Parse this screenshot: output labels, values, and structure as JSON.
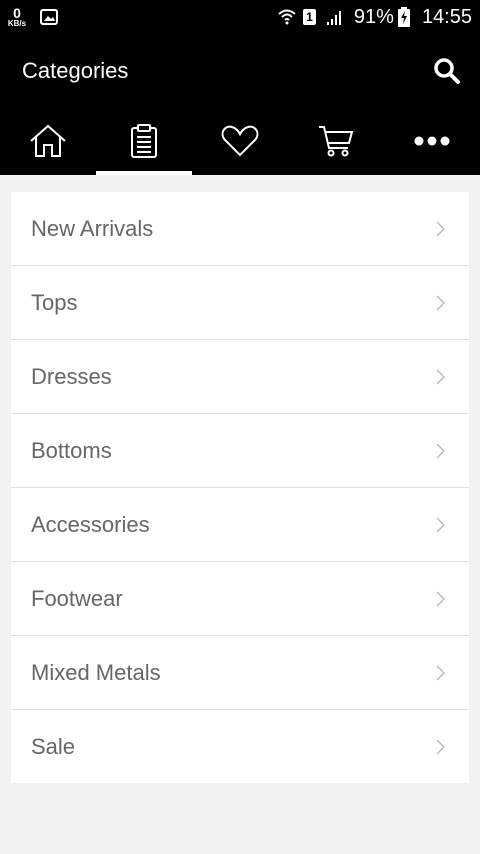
{
  "status_bar": {
    "speed_value": "0",
    "speed_unit": "KB/s",
    "battery_percent": "91%",
    "time": "14:55",
    "sim_slot": "1"
  },
  "header": {
    "title": "Categories"
  },
  "tabs": [
    {
      "icon": "home-icon",
      "active": false
    },
    {
      "icon": "clipboard-icon",
      "active": true
    },
    {
      "icon": "heart-icon",
      "active": false
    },
    {
      "icon": "cart-icon",
      "active": false
    },
    {
      "icon": "more-icon",
      "active": false
    }
  ],
  "categories": [
    {
      "label": "New Arrivals"
    },
    {
      "label": "Tops"
    },
    {
      "label": "Dresses"
    },
    {
      "label": "Bottoms"
    },
    {
      "label": "Accessories"
    },
    {
      "label": "Footwear"
    },
    {
      "label": "Mixed Metals"
    },
    {
      "label": "Sale"
    }
  ],
  "colors": {
    "header_bg": "#000000",
    "page_bg": "#f2f2f2",
    "item_text": "#666666"
  }
}
